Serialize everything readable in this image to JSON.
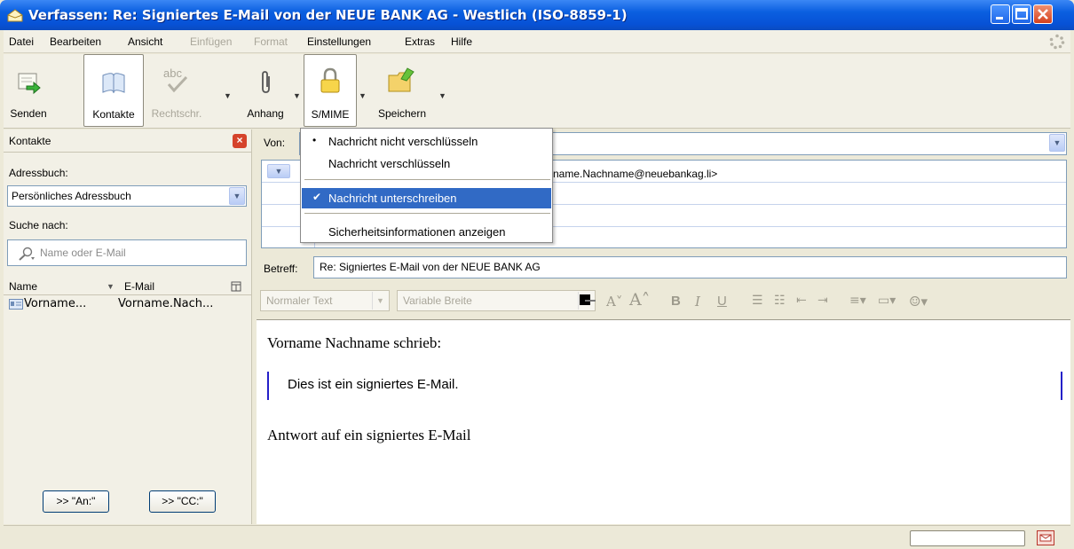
{
  "window": {
    "title": "Verfassen: Re: Signiertes E-Mail von der NEUE BANK AG - Westlich (ISO-8859-1)"
  },
  "menubar": {
    "items": [
      {
        "label": "Datei",
        "disabled": false
      },
      {
        "label": "Bearbeiten",
        "disabled": false
      },
      {
        "label": "Ansicht",
        "disabled": false
      },
      {
        "label": "Einfügen",
        "disabled": true
      },
      {
        "label": "Format",
        "disabled": true
      },
      {
        "label": "Einstellungen",
        "disabled": false
      },
      {
        "label": "Extras",
        "disabled": false
      },
      {
        "label": "Hilfe",
        "disabled": false
      }
    ]
  },
  "toolbar": {
    "send": "Senden",
    "contacts": "Kontakte",
    "spell": "Rechtschr.",
    "attach": "Anhang",
    "smime": "S/MIME",
    "save": "Speichern"
  },
  "sidebar": {
    "title": "Kontakte",
    "addressbook_label": "Adressbuch:",
    "addressbook_value": "Persönliches Adressbuch",
    "search_label": "Suche nach:",
    "search_placeholder": "Name oder E-Mail",
    "col_name": "Name",
    "col_email": "E-Mail",
    "contacts": [
      {
        "name": "Vorname...",
        "email": "Vorname.Nach..."
      }
    ],
    "btn_to": ">> \"An:\"",
    "btn_cc": ">> \"CC:\""
  },
  "compose": {
    "from_label": "Von:",
    "to_address_partial": "name.Nachname@neuebankag.li>",
    "subject_label": "Betreff:",
    "subject_value": "Re: Signiertes E-Mail von der NEUE BANK AG"
  },
  "format": {
    "paragraph_style": "Normaler Text",
    "font": "Variable Breite"
  },
  "body": {
    "quote_header": "Vorname Nachname schrieb:",
    "quote_text": "Dies ist ein signiertes E-Mail.",
    "reply_text": "Antwort auf ein signiertes E-Mail"
  },
  "smime_menu": {
    "items": [
      {
        "label": "Nachricht nicht verschlüsseln",
        "mark": "•",
        "highlighted": false
      },
      {
        "label": "Nachricht verschlüsseln",
        "mark": "",
        "highlighted": false
      },
      {
        "label": "Nachricht unterschreiben",
        "mark": "✔",
        "highlighted": true
      },
      {
        "label": "Sicherheitsinformationen anzeigen",
        "mark": "",
        "highlighted": false
      }
    ]
  },
  "colors": {
    "titlebar": "#0751d6",
    "highlight": "#316ac5",
    "quote_bar": "#2420c9"
  }
}
